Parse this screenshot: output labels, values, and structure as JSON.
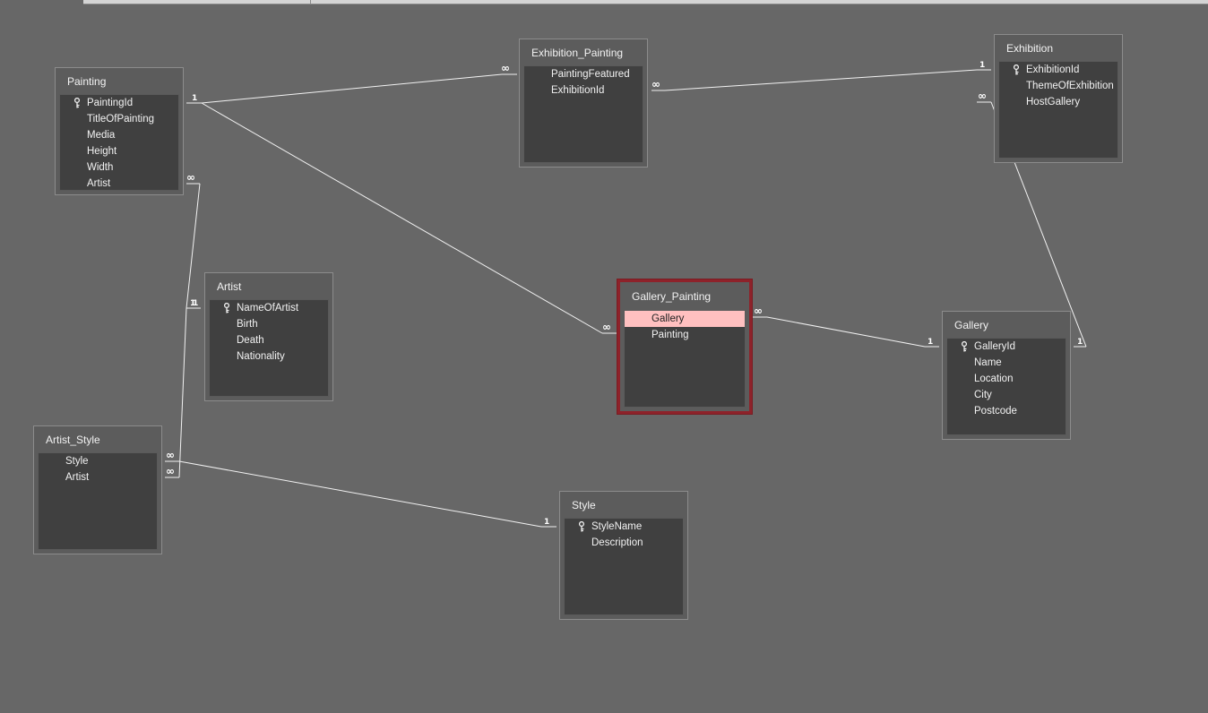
{
  "tables": {
    "painting": {
      "name": "Painting",
      "fields": [
        "PaintingId",
        "TitleOfPainting",
        "Media",
        "Height",
        "Width",
        "Artist"
      ],
      "key_field": "PaintingId"
    },
    "exhibition_painting": {
      "name": "Exhibition_Painting",
      "fields": [
        "PaintingFeatured",
        "ExhibitionId"
      ]
    },
    "exhibition": {
      "name": "Exhibition",
      "fields": [
        "ExhibitionId",
        "ThemeOfExhibition",
        "HostGallery"
      ],
      "key_field": "ExhibitionId"
    },
    "artist": {
      "name": "Artist",
      "fields": [
        "NameOfArtist",
        "Birth",
        "Death",
        "Nationality"
      ],
      "key_field": "NameOfArtist"
    },
    "gallery_painting": {
      "name": "Gallery_Painting",
      "fields": [
        "Gallery",
        "Painting"
      ],
      "selected_field": "Gallery"
    },
    "gallery": {
      "name": "Gallery",
      "fields": [
        "GalleryId",
        "Name",
        "Location",
        "City",
        "Postcode"
      ],
      "key_field": "GalleryId"
    },
    "artist_style": {
      "name": "Artist_Style",
      "fields": [
        "Style",
        "Artist"
      ]
    },
    "style": {
      "name": "Style",
      "fields": [
        "StyleName",
        "Description"
      ],
      "key_field": "StyleName"
    }
  },
  "relationships": [
    {
      "from": "Painting.PaintingId",
      "to": "Exhibition_Painting.PaintingFeatured",
      "one_label": "1",
      "many_label": "∞"
    },
    {
      "from": "Exhibition.ExhibitionId",
      "to": "Exhibition_Painting.ExhibitionId",
      "one_label": "1",
      "many_label": "∞"
    },
    {
      "from": "Painting.PaintingId",
      "to": "Gallery_Painting.Painting",
      "one_label": "1",
      "many_label": "∞"
    },
    {
      "from": "Gallery.GalleryId",
      "to": "Gallery_Painting.Gallery",
      "one_label": "1",
      "many_label": "∞"
    },
    {
      "from": "Gallery.GalleryId",
      "to": "Exhibition.HostGallery",
      "one_label": "1",
      "many_label": "∞"
    },
    {
      "from": "Artist.NameOfArtist",
      "to": "Painting.Artist",
      "one_label": "1",
      "many_label": "∞"
    },
    {
      "from": "Artist.NameOfArtist",
      "to": "Artist_Style.Artist",
      "one_label": "1",
      "many_label": "∞"
    },
    {
      "from": "Style.StyleName",
      "to": "Artist_Style.Style",
      "one_label": "1",
      "many_label": "∞"
    }
  ],
  "colors": {
    "canvas": "#676767",
    "field_list": "#404040",
    "selection_border": "#8e222a",
    "selected_field": "#ffc0c0",
    "line": "#f2f2f2"
  },
  "icons": {
    "key_field_marker": "key-icon"
  }
}
